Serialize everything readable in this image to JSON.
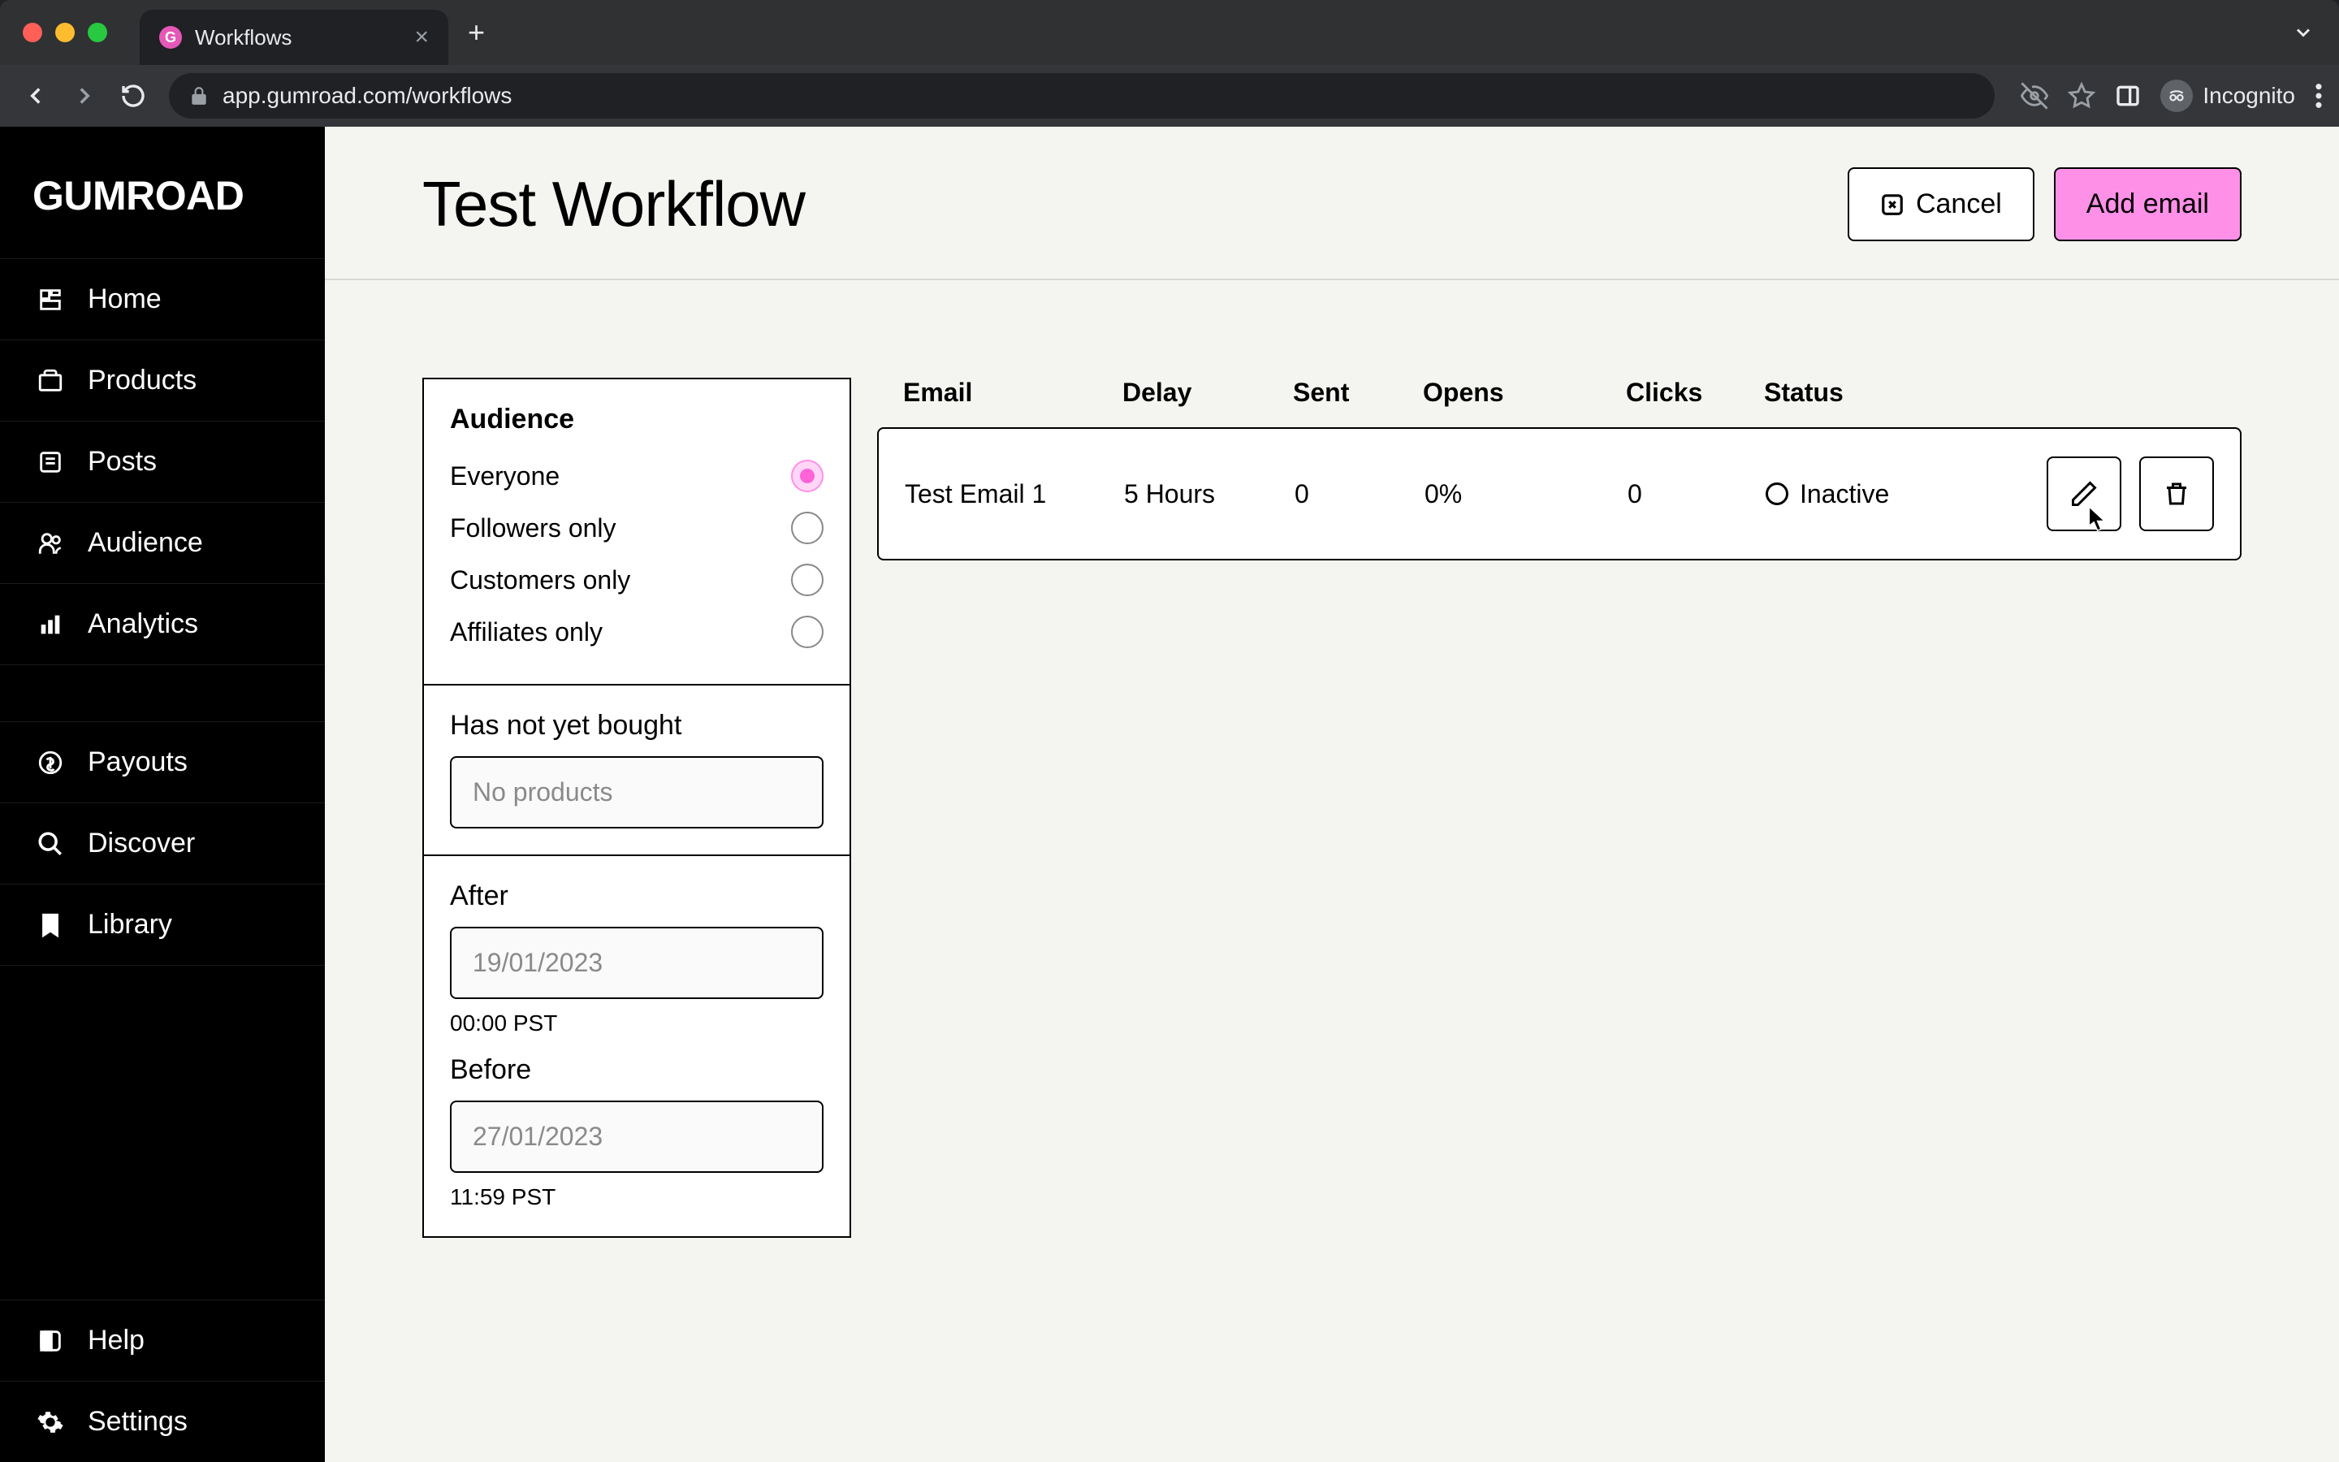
{
  "browser": {
    "tab_title": "Workflows",
    "url": "app.gumroad.com/workflows",
    "incognito_label": "Incognito"
  },
  "brand": {
    "logo": "GUMROAD"
  },
  "sidebar": {
    "items": [
      {
        "label": "Home"
      },
      {
        "label": "Products"
      },
      {
        "label": "Posts"
      },
      {
        "label": "Audience"
      },
      {
        "label": "Analytics"
      },
      {
        "label": "Payouts"
      },
      {
        "label": "Discover"
      },
      {
        "label": "Library"
      }
    ],
    "footer": [
      {
        "label": "Help"
      },
      {
        "label": "Settings"
      }
    ]
  },
  "header": {
    "title": "Test Workflow",
    "cancel_label": "Cancel",
    "add_email_label": "Add email"
  },
  "filters": {
    "audience_title": "Audience",
    "options": [
      {
        "label": "Everyone"
      },
      {
        "label": "Followers only"
      },
      {
        "label": "Customers only"
      },
      {
        "label": "Affiliates only"
      }
    ],
    "not_bought_label": "Has not yet bought",
    "not_bought_placeholder": "No products",
    "after_label": "After",
    "after_value": "19/01/2023",
    "after_hint": "00:00 PST",
    "before_label": "Before",
    "before_value": "27/01/2023",
    "before_hint": "11:59 PST"
  },
  "emails": {
    "columns": {
      "email": "Email",
      "delay": "Delay",
      "sent": "Sent",
      "opens": "Opens",
      "clicks": "Clicks",
      "status": "Status"
    },
    "rows": [
      {
        "email": "Test Email 1",
        "delay": "5 Hours",
        "sent": "0",
        "opens": "0%",
        "clicks": "0",
        "status": "Inactive"
      }
    ]
  },
  "colors": {
    "accent": "#ff90e8",
    "bg": "#f4f4f0"
  }
}
